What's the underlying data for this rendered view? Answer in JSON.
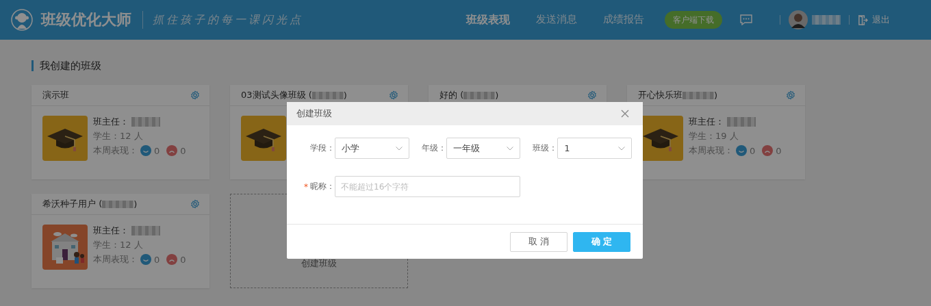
{
  "header": {
    "brand": "班级优化大师",
    "slogan": "抓住孩子的每一课闪光点",
    "nav": [
      {
        "label": "班级表现",
        "selected": true
      },
      {
        "label": "发送消息",
        "selected": false
      },
      {
        "label": "成绩报告",
        "selected": false
      }
    ],
    "download": "客户端下载",
    "logout": "退出"
  },
  "section_title": "我创建的班级",
  "classes": [
    {
      "title": "演示班",
      "code_blurred": false,
      "kind": "cap",
      "teacher_label": "班主任：",
      "students": "学生：12 人",
      "weekly_label": "本周表现：",
      "praise": "0",
      "criticism": "0"
    },
    {
      "title": "03测试头像班级 (",
      "code_blurred": true,
      "title_end": ")",
      "kind": "cap"
    },
    {
      "title": "好的 (",
      "code_blurred": true,
      "title_end": ")"
    },
    {
      "title": "开心快乐班",
      "code_blurred": true,
      "title_end": ")",
      "kind": "cap",
      "teacher_label": "班主任：",
      "students": "学生：19 人",
      "weekly_label": "本周表现：",
      "praise": "0",
      "criticism": "0"
    },
    {
      "title": "希沃种子用户 (",
      "code_blurred": true,
      "title_end": ")",
      "kind": "picture",
      "teacher_label": "班主任：",
      "students": "学生：12 人",
      "weekly_label": "本周表现：",
      "praise": "0",
      "criticism": "0"
    }
  ],
  "add_card": {
    "label": "创建班级"
  },
  "dialog": {
    "title": "创建班级",
    "selects": [
      {
        "label": "学段：",
        "value": "小学"
      },
      {
        "label": "年级：",
        "value": "一年级"
      },
      {
        "label": "班级：",
        "value": "1"
      }
    ],
    "nickname": {
      "label": "昵称：",
      "required_mark": "*",
      "placeholder": "不能超过16个字符"
    },
    "buttons": [
      {
        "label": "取 消",
        "kind": "secondary"
      },
      {
        "label": "确 定",
        "kind": "primary"
      }
    ]
  }
}
